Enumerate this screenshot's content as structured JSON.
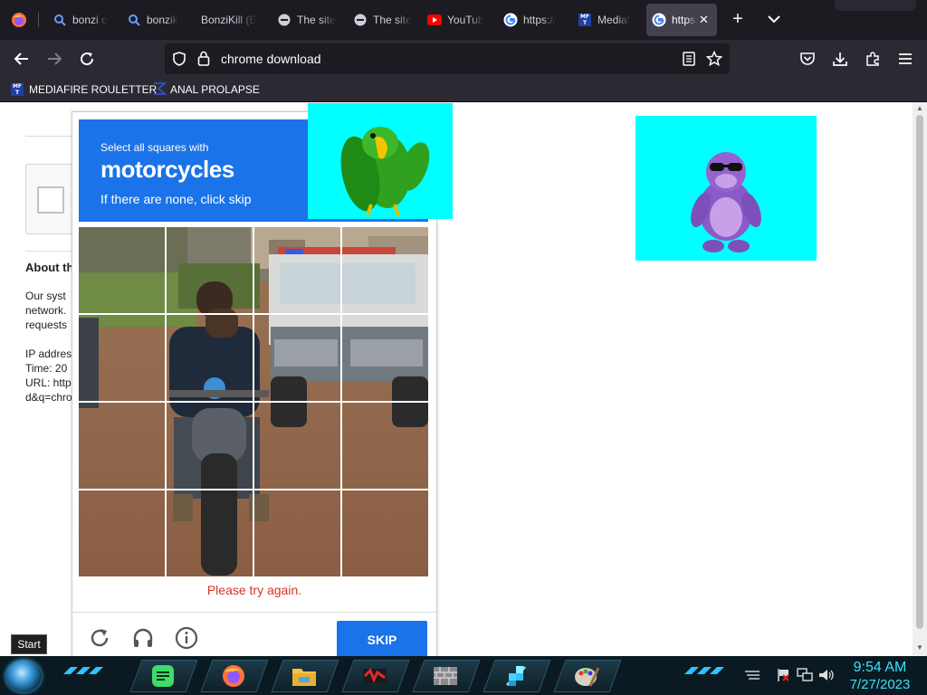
{
  "browser": {
    "tabs": [
      {
        "title": "bonzi o",
        "icon": "firefox-search-icon"
      },
      {
        "title": "bonzik",
        "icon": "firefox-search-icon"
      },
      {
        "title": "BonziKill (B",
        "icon": "none"
      },
      {
        "title": "The site",
        "icon": "blocked-icon"
      },
      {
        "title": "The site",
        "icon": "blocked-icon"
      },
      {
        "title": "YouTub",
        "icon": "youtube-icon"
      },
      {
        "title": "https://",
        "icon": "google-icon"
      },
      {
        "title": "Mediaf",
        "icon": "mediafire-icon"
      },
      {
        "title": "https",
        "icon": "google-icon",
        "active": true
      }
    ],
    "url": "chrome download",
    "bookmarks": [
      {
        "label": "MEDIAFIRE ROULETTER",
        "icon": "mft-icon"
      },
      {
        "label": "ANAL PROLAPSE",
        "icon": "sigma-icon"
      }
    ]
  },
  "page": {
    "about_heading": "About th",
    "body_lines": [
      "Our syst",
      "network.",
      "requests"
    ],
    "meta_lines": [
      "IP addres",
      "Time: 20",
      "URL: http",
      "d&q=chro"
    ]
  },
  "captcha": {
    "subtitle": "Select all squares with",
    "target": "motorcycles",
    "hint": "If there are none, click skip",
    "error": "Please try again.",
    "skip_label": "SKIP",
    "footer_icons": [
      "reload-icon",
      "headphones-icon",
      "info-icon"
    ]
  },
  "taskbar": {
    "start_tooltip": "Start",
    "time": "9:54 AM",
    "date": "7/27/2023",
    "apps": [
      "notes-app-icon",
      "firefox-icon",
      "file-explorer-icon",
      "media-app-icon",
      "bricks-app-icon",
      "tiles-app-icon",
      "paint-icon"
    ]
  },
  "colors": {
    "captcha_blue": "#1a73e8",
    "error_red": "#d93025",
    "cyan_box": "#00ffff",
    "tab_bg": "#1c1b22",
    "toolbar_bg": "#2b2a33",
    "clock_color": "#35e0ff"
  }
}
